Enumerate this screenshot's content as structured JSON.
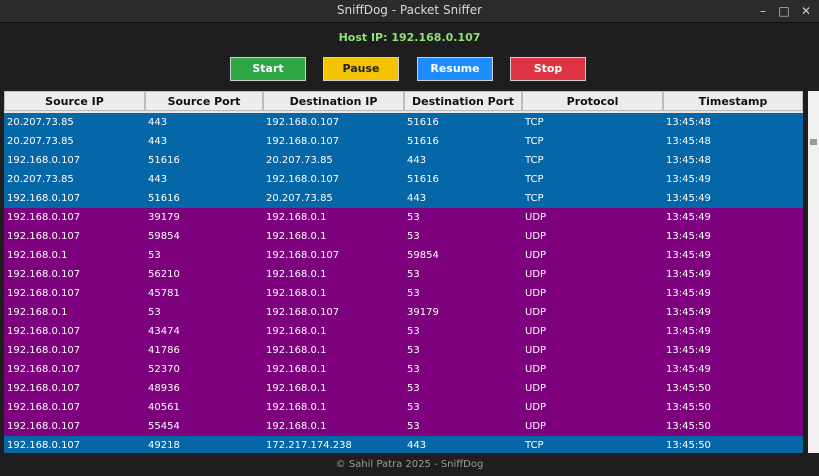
{
  "window": {
    "title": "SniffDog - Packet Sniffer",
    "minimize": "–",
    "maximize": "□",
    "close": "✕"
  },
  "host": {
    "label": "Host IP: 192.168.0.107"
  },
  "controls": {
    "start": "Start",
    "pause": "Pause",
    "resume": "Resume",
    "stop": "Stop"
  },
  "table": {
    "columns": [
      "Source IP",
      "Source Port",
      "Destination IP",
      "Destination Port",
      "Protocol",
      "Timestamp"
    ],
    "rows": [
      [
        "20.207.73.85",
        "443",
        "192.168.0.107",
        "51616",
        "TCP",
        "13:45:48"
      ],
      [
        "20.207.73.85",
        "443",
        "192.168.0.107",
        "51616",
        "TCP",
        "13:45:48"
      ],
      [
        "192.168.0.107",
        "51616",
        "20.207.73.85",
        "443",
        "TCP",
        "13:45:48"
      ],
      [
        "20.207.73.85",
        "443",
        "192.168.0.107",
        "51616",
        "TCP",
        "13:45:49"
      ],
      [
        "192.168.0.107",
        "51616",
        "20.207.73.85",
        "443",
        "TCP",
        "13:45:49"
      ],
      [
        "192.168.0.107",
        "39179",
        "192.168.0.1",
        "53",
        "UDP",
        "13:45:49"
      ],
      [
        "192.168.0.107",
        "59854",
        "192.168.0.1",
        "53",
        "UDP",
        "13:45:49"
      ],
      [
        "192.168.0.1",
        "53",
        "192.168.0.107",
        "59854",
        "UDP",
        "13:45:49"
      ],
      [
        "192.168.0.107",
        "56210",
        "192.168.0.1",
        "53",
        "UDP",
        "13:45:49"
      ],
      [
        "192.168.0.107",
        "45781",
        "192.168.0.1",
        "53",
        "UDP",
        "13:45:49"
      ],
      [
        "192.168.0.1",
        "53",
        "192.168.0.107",
        "39179",
        "UDP",
        "13:45:49"
      ],
      [
        "192.168.0.107",
        "43474",
        "192.168.0.1",
        "53",
        "UDP",
        "13:45:49"
      ],
      [
        "192.168.0.107",
        "41786",
        "192.168.0.1",
        "53",
        "UDP",
        "13:45:49"
      ],
      [
        "192.168.0.107",
        "52370",
        "192.168.0.1",
        "53",
        "UDP",
        "13:45:49"
      ],
      [
        "192.168.0.107",
        "48936",
        "192.168.0.1",
        "53",
        "UDP",
        "13:45:50"
      ],
      [
        "192.168.0.107",
        "40561",
        "192.168.0.1",
        "53",
        "UDP",
        "13:45:50"
      ],
      [
        "192.168.0.107",
        "55454",
        "192.168.0.1",
        "53",
        "UDP",
        "13:45:50"
      ],
      [
        "192.168.0.107",
        "49218",
        "172.217.174.238",
        "443",
        "TCP",
        "13:45:50"
      ]
    ]
  },
  "colors": {
    "tcp_row": "#0667a8",
    "udp_row": "#7d007d",
    "host_ip_text": "#8ee07a",
    "start": "#2ea644",
    "pause": "#f5c400",
    "resume": "#1c8cff",
    "stop": "#dd3344"
  },
  "footer": {
    "text": "© Sahil Patra 2025 - SniffDog"
  }
}
